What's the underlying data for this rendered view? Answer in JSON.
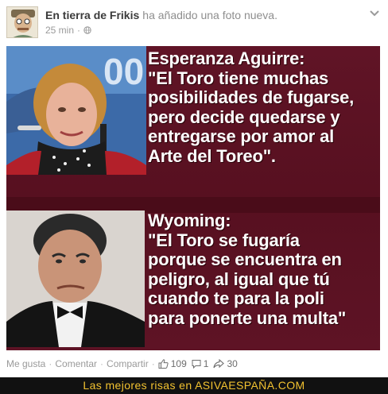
{
  "post": {
    "author": "En tierra de Frikis",
    "action": "ha añadido una foto nueva.",
    "time": "25 min",
    "privacy_icon": "globe-icon",
    "menu_icon": "chevron-down-icon"
  },
  "photo": {
    "top_quote": {
      "speaker": "Esperanza Aguirre:",
      "lines": [
        "\"El Toro tiene muchas",
        "posibilidades de fugarse,",
        "pero decide quedarse y",
        "entregarse por amor al",
        "Arte del Toreo\"."
      ]
    },
    "bottom_quote": {
      "speaker": "Wyoming:",
      "lines": [
        "\"El Toro se fugaría",
        "porque se encuentra en",
        "peligro, al igual que tú",
        "cuando te para la poli",
        "para ponerte una multa\""
      ]
    }
  },
  "footer": {
    "like": "Me gusta",
    "comment": "Comentar",
    "share": "Compartir",
    "likes_count": "109",
    "comments_count": "1",
    "shares_count": "30"
  },
  "watermark": {
    "text": "Las mejores risas en ASIVAESPAÑA.COM"
  },
  "colors": {
    "photo_background": "#5c1222",
    "watermark_text": "#f2c230",
    "watermark_background": "#111111"
  }
}
